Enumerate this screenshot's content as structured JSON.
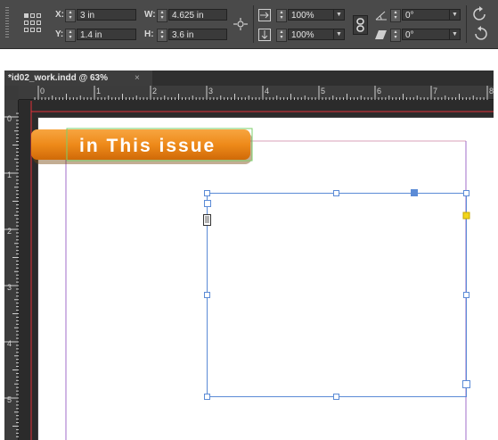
{
  "control_panel": {
    "x_label": "X:",
    "x_value": "3 in",
    "y_label": "Y:",
    "y_value": "1.4 in",
    "w_label": "W:",
    "w_value": "4.625 in",
    "h_label": "H:",
    "h_value": "3.6 in",
    "scale_x_value": "100%",
    "scale_y_value": "100%",
    "rotation_value": "0°",
    "shear_value": "0°"
  },
  "document": {
    "tab_title": "*id02_work.indd @ 63%",
    "close_glyph": "×",
    "h_ruler_labels": [
      "0",
      "1",
      "2",
      "3",
      "4",
      "5",
      "6",
      "7",
      "8"
    ],
    "v_ruler_labels": [
      "0",
      "1",
      "2",
      "3",
      "4",
      "5"
    ],
    "banner_text": "in This issue"
  },
  "colors": {
    "panel_bg": "#4a4a4a",
    "banner_orange": "#f08a1c",
    "frame_blue": "#5b8bd6",
    "margin_purple": "#a06cc8",
    "bleed_red": "#e0303a"
  }
}
